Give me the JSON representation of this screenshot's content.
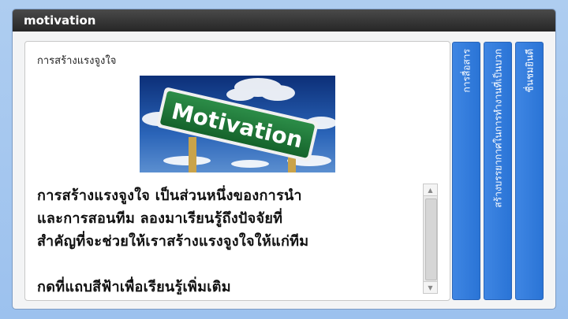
{
  "window": {
    "title": "motivation"
  },
  "content": {
    "heading": "การสร้างแรงจูงใจ",
    "image": {
      "sign_text": "Motivation"
    },
    "paragraph_lines": [
      "การสร้างแรงจูงใจ เป็นส่วนหนึ่งของการนำ",
      "และการสอนทีม   ลองมาเรียนรู้ถึงปัจจัยที่",
      "สำคัญที่จะช่วยให้เราสร้างแรงจูงใจให้แก่ทีม"
    ],
    "instruction": "กดที่แถบสีฟ้าเพื่อเรียนรู้เพิ่มเติม"
  },
  "tabs": [
    {
      "label": "การสื่อสาร"
    },
    {
      "label": "สร้างบรรยากาศในการทำงานที่เป็นบวก"
    },
    {
      "label": "ชื่นชมยินดี"
    }
  ],
  "colors": {
    "tab_blue": "#2f7ad9",
    "titlebar": "#2e2e2e",
    "sign_green": "#1f7a3a",
    "background": "#a7c8ef"
  }
}
